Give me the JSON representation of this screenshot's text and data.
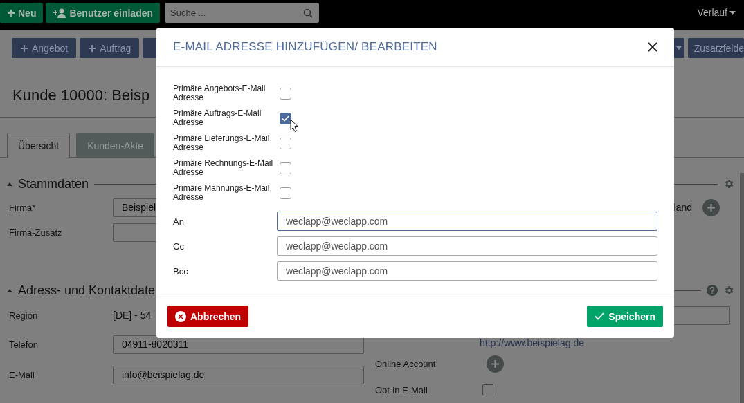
{
  "top_bar": {
    "buttons": [
      {
        "kind": "add",
        "label": "Neu"
      },
      {
        "kind": "invite",
        "label": "Benutzer einladen"
      }
    ],
    "search": {
      "placeholder": "Suche ..."
    },
    "history_menu": {
      "label": "Verlauf"
    }
  },
  "toolbar": {
    "buttons": [
      {
        "label": "Angebot"
      },
      {
        "label": "Auftrag"
      }
    ],
    "right_button": {
      "label": "Zusatzfelde"
    }
  },
  "page_title": "Kunde 10000: Beisp",
  "tabs": [
    {
      "label": "Übersicht",
      "selected": true
    },
    {
      "label": "Kunden-Akte",
      "selected": false
    }
  ],
  "master_data": {
    "title": "Stammdaten",
    "expanded": true,
    "fields": [
      {
        "label": "Firma*",
        "value": "Beispiel"
      },
      {
        "label": "Firma-Zusatz"
      }
    ],
    "country_text": "land"
  },
  "contact_data": {
    "title": "Adress- und Kontaktdate",
    "expanded": true,
    "region": {
      "label": "Region",
      "value": "[DE] - 54"
    },
    "fields": [
      {
        "label": "Telefon",
        "value": "04911-8020311"
      },
      {
        "label": "E-Mail",
        "value": "info@beispielag.de"
      }
    ],
    "website": "http://www.beispielag.de",
    "online_account": {
      "label": "Online Account"
    },
    "opt_in": {
      "label": "Opt-in E-Mail",
      "checked": false
    }
  },
  "dialog": {
    "title": "E-MAIL ADRESSE HINZUFÜGEN/ BEARBEITEN",
    "checkboxes": [
      {
        "label": "Primäre Angebots-E-Mail Adresse",
        "checked": false
      },
      {
        "label": "Primäre Auftrags-E-Mail Adresse",
        "checked": true
      },
      {
        "label": "Primäre Lieferungs-E-Mail Adresse",
        "checked": false
      },
      {
        "label": "Primäre Rechnungs-E-Mail Adresse",
        "checked": false
      },
      {
        "label": "Primäre Mahnungs-E-Mail Adresse",
        "checked": false
      }
    ],
    "recipients": [
      {
        "label": "An",
        "value": "weclapp@weclapp.com",
        "focused": true
      },
      {
        "label": "Cc",
        "value": "weclapp@weclapp.com",
        "focused": false
      },
      {
        "label": "Bcc",
        "value": "weclapp@weclapp.com",
        "focused": false
      }
    ],
    "cancel_button": {
      "label": "Abbrechen"
    },
    "save_button": {
      "label": "Speichern"
    }
  }
}
